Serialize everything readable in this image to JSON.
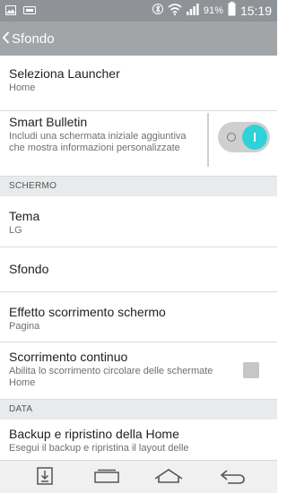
{
  "status_bar": {
    "battery": "91%",
    "time": "15:19",
    "icons": [
      "image-icon",
      "sd-icon",
      "bluetooth-icon",
      "wifi-icon",
      "signal-icon",
      "battery-icon"
    ]
  },
  "action_bar": {
    "title": "Sfondo"
  },
  "rows": {
    "launcher": {
      "title": "Seleziona Launcher",
      "sub": "Home"
    },
    "smart": {
      "title": "Smart Bulletin",
      "sub": "Includi una schermata iniziale aggiuntiva che mostra informazioni personalizzate",
      "enabled": true
    },
    "tema": {
      "title": "Tema",
      "sub": "LG"
    },
    "sfondo": {
      "title": "Sfondo"
    },
    "effetto": {
      "title": "Effetto scorrimento schermo",
      "sub": "Pagina"
    },
    "continuo": {
      "title": "Scorrimento continuo",
      "sub": "Abilita lo scorrimento circolare delle schermate Home",
      "checked": false
    },
    "backup": {
      "title": "Backup e ripristino della Home",
      "sub": "Esegui il backup e ripristina il layout delle"
    }
  },
  "sections": {
    "schermo": "SCHERMO",
    "data": "DATA"
  },
  "nav": [
    "download-icon",
    "recents-icon",
    "home-icon",
    "back-icon"
  ],
  "colors": {
    "accent": "#2ed3d8",
    "status_bar": "#8f9397",
    "action_bar": "#a1a5a8"
  }
}
